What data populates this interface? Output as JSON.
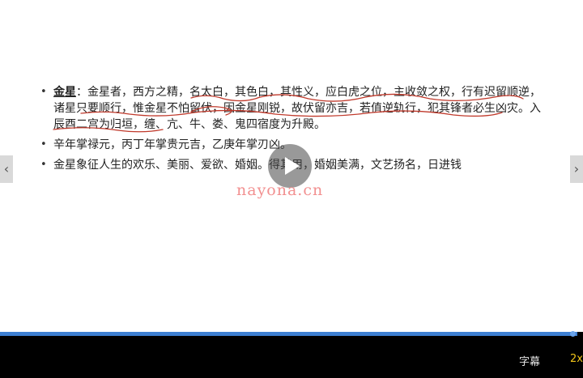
{
  "slide": {
    "bullets": [
      {
        "term": "金星",
        "text": "：金星者，西方之精，名太白，其色白，其性义，应白虎之位，主收敛之权，行有迟留顺逆，诸星只要顺行，惟金星不怕留伏，因金星刚锐，故伏留亦吉，若值逆轨行，犯其锋者必生凶灾。入辰酉二宫为归垣，缠、亢、牛、娄、鬼四宿度为升殿。"
      },
      {
        "term": "",
        "text": "辛年掌禄元，丙丁年掌贵元吉，乙庚年掌刃凶。"
      },
      {
        "term": "",
        "text": "金星象征人生的欢乐、美丽、爱欲、婚姻。得其用，婚姻美满，文艺扬名，日进钱"
      }
    ],
    "annotation_color": "#c0392b"
  },
  "watermark": "nayona.cn",
  "nav": {
    "prev": "‹",
    "next": "›"
  },
  "player": {
    "progress": 0.99,
    "subtitle_label": "字幕",
    "speed_label": "2x",
    "progress_color": "#3d7fd1",
    "speed_color": "#f0c419"
  }
}
